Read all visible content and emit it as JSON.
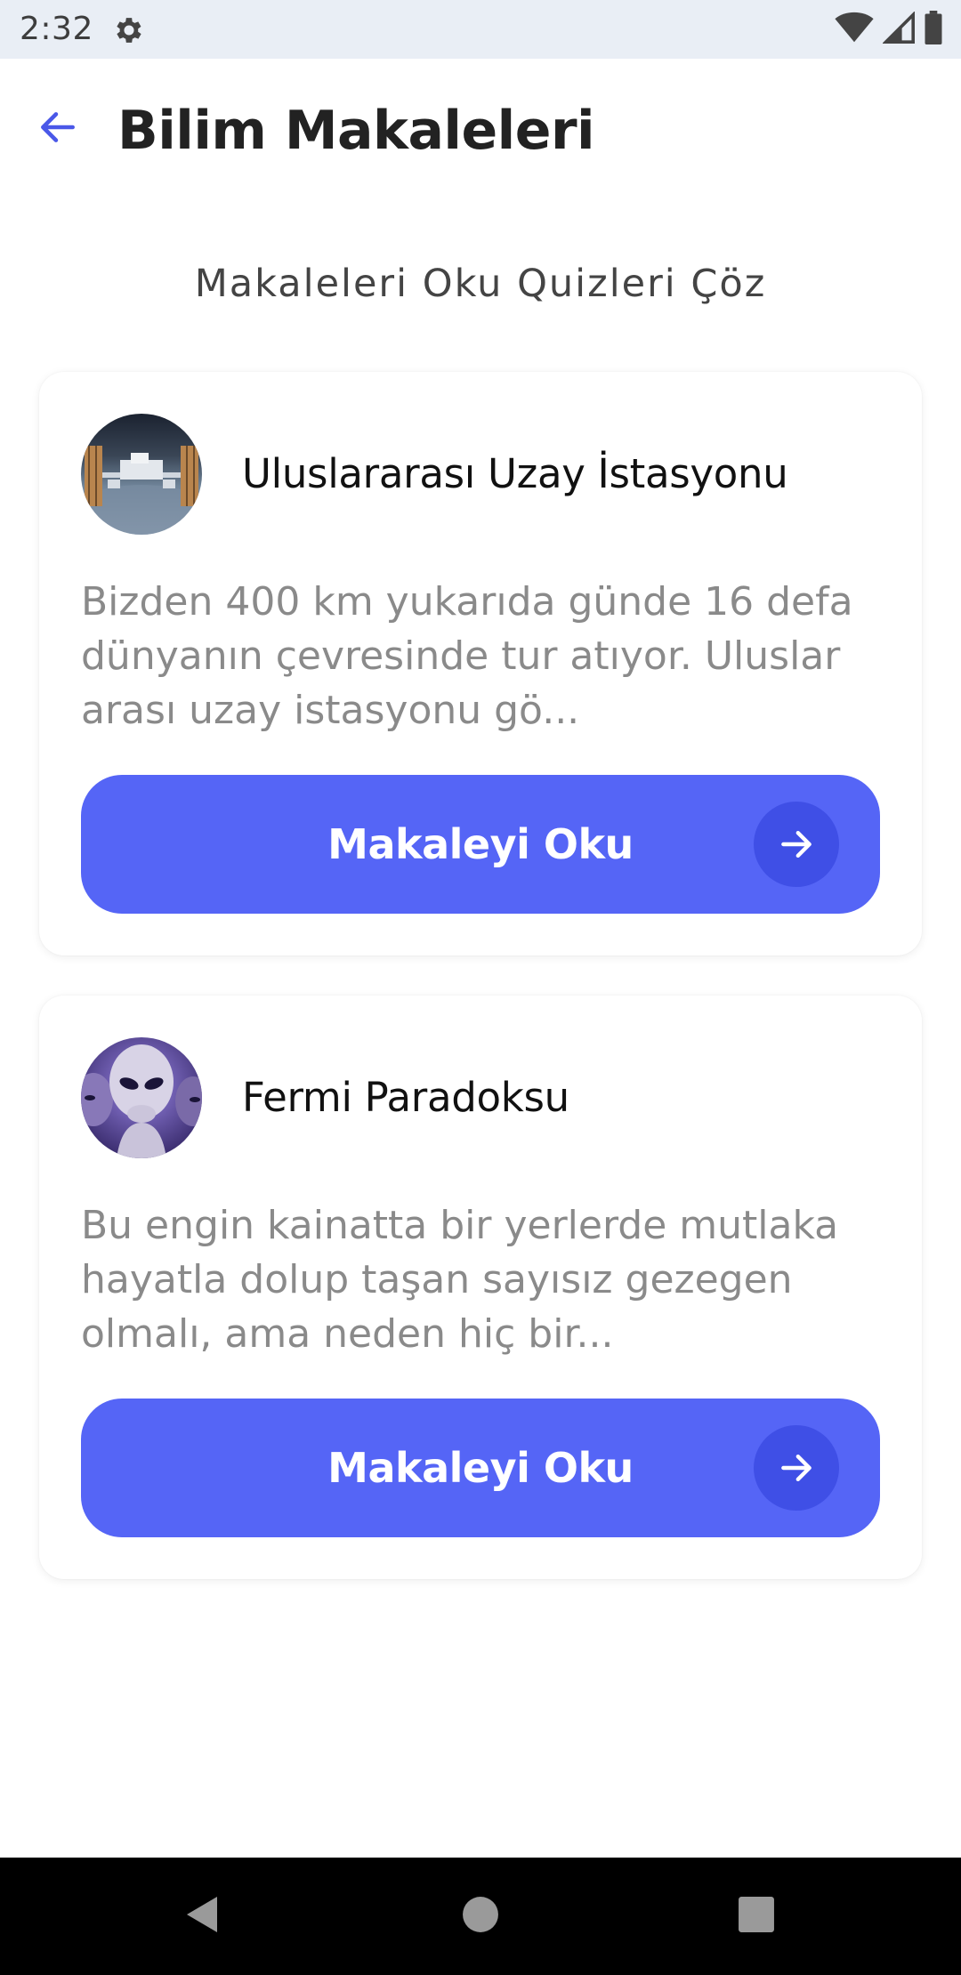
{
  "status_bar": {
    "time": "2:32",
    "icons": [
      "gear-icon",
      "wifi-icon",
      "cell-signal-icon",
      "battery-icon"
    ]
  },
  "app_bar": {
    "back_icon": "arrow-left-icon",
    "title": "Bilim Makaleleri"
  },
  "subtitle": "Makaleleri Oku Quizleri Çöz",
  "articles": [
    {
      "title": "Uluslararası Uzay İstasyonu",
      "description": "Bizden 400 km yukarıda günde 16 defa dünyanın çevresinde tur atıyor. Uluslar arası uzay istasyonu gö...",
      "button_label": "Makaleyi Oku",
      "image": "space-station-photo"
    },
    {
      "title": "Fermi Paradoksu",
      "description": "Bu engin kainatta bir yerlerde mutlaka hayatla dolup taşan sayısız gezegen olmalı, ama neden hiç bir...",
      "button_label": "Makaleyi Oku",
      "image": "alien-photo"
    }
  ],
  "colors": {
    "accent": "#5565f6",
    "accent_dark": "#3f4fe6",
    "status_bar_bg": "#e9eef5",
    "title_text": "#222222",
    "body_text": "#8a8a8a"
  },
  "nav_bar": {
    "icons": [
      "nav-back-icon",
      "nav-home-icon",
      "nav-recents-icon"
    ]
  }
}
